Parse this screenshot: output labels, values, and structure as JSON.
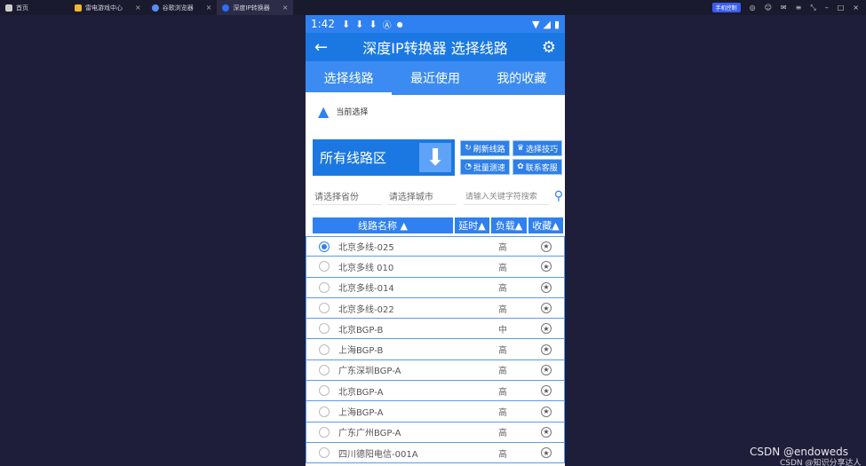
{
  "emulator": {
    "tabs": [
      {
        "label": "首页",
        "color": "#cccccc"
      },
      {
        "label": "雷电游戏中心",
        "color": "#f2b632"
      },
      {
        "label": "谷歌浏览器",
        "color": "#5b8df0"
      },
      {
        "label": "深度IP转换器",
        "color": "#2f6ef0"
      }
    ],
    "pill_label": "手机控制"
  },
  "status": {
    "time": "1:42"
  },
  "appbar": {
    "title": "深度IP转换器 选择线路"
  },
  "tabs": [
    {
      "label": "选择线路"
    },
    {
      "label": "最近使用"
    },
    {
      "label": "我的收藏"
    }
  ],
  "current": {
    "label": "当前选择"
  },
  "region": {
    "label": "所有线路区"
  },
  "buttons": {
    "refresh": "刷新线路",
    "tips": "选择技巧",
    "batch": "批量测速",
    "support": "联系客服"
  },
  "filters": {
    "province": "请选择省份",
    "city": "请选择城市",
    "keyword_placeholder": "请输入关键字符搜索"
  },
  "table": {
    "headers": [
      "线路名称 ▲",
      "延时▲",
      "负载▲",
      "收藏▲"
    ],
    "rows": [
      {
        "name": "北京多线-025",
        "load": "高",
        "selected": true
      },
      {
        "name": "北京多线 010",
        "load": "高",
        "selected": false
      },
      {
        "name": "北京多线-014",
        "load": "高",
        "selected": false
      },
      {
        "name": "北京多线-022",
        "load": "高",
        "selected": false
      },
      {
        "name": "北京BGP-B",
        "load": "中",
        "selected": false
      },
      {
        "name": "上海BGP-B",
        "load": "高",
        "selected": false
      },
      {
        "name": "广东深圳BGP-A",
        "load": "高",
        "selected": false
      },
      {
        "name": "北京BGP-A",
        "load": "高",
        "selected": false
      },
      {
        "name": "上海BGP-A",
        "load": "高",
        "selected": false
      },
      {
        "name": "广东广州BGP-A",
        "load": "高",
        "selected": false
      },
      {
        "name": "四川德阳电信-001A",
        "load": "高",
        "selected": false
      }
    ]
  },
  "watermark": {
    "line1": "CSDN @endoweds",
    "line2": "CSDN @知识分享达人"
  }
}
